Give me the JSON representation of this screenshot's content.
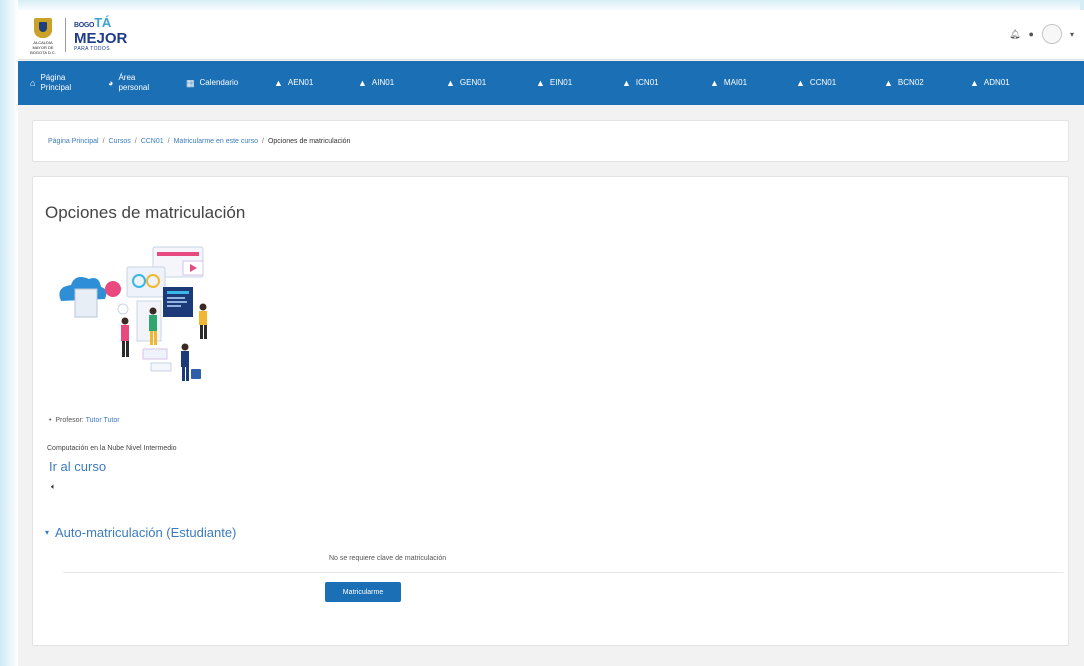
{
  "header": {
    "crest_text": "ALCALDIA MAYOR DE BOGOTA D.C.",
    "brand_prefix": "BOGO",
    "brand_accent": "TÁ",
    "brand_line2": "MEJOR",
    "brand_line3": "PARA TODOS"
  },
  "nav": {
    "items": [
      {
        "icon": "home-icon",
        "line1": "Página",
        "line2": "Principal"
      },
      {
        "icon": "dashboard-icon",
        "line1": "Área",
        "line2": "personal"
      },
      {
        "icon": "calendar-icon",
        "line1": "Calendario",
        "line2": ""
      },
      {
        "icon": "graduation-cap-icon",
        "line1": "AEN01",
        "line2": ""
      },
      {
        "icon": "graduation-cap-icon",
        "line1": "AIN01",
        "line2": ""
      },
      {
        "icon": "graduation-cap-icon",
        "line1": "GEN01",
        "line2": ""
      },
      {
        "icon": "graduation-cap-icon",
        "line1": "EIN01",
        "line2": ""
      },
      {
        "icon": "graduation-cap-icon",
        "line1": "ICN01",
        "line2": ""
      },
      {
        "icon": "graduation-cap-icon",
        "line1": "MAI01",
        "line2": ""
      },
      {
        "icon": "graduation-cap-icon",
        "line1": "CCN01",
        "line2": ""
      },
      {
        "icon": "graduation-cap-icon",
        "line1": "BCN02",
        "line2": ""
      },
      {
        "icon": "graduation-cap-icon",
        "line1": "ADN01",
        "line2": ""
      }
    ]
  },
  "breadcrumb": {
    "items": [
      "Página Principal",
      "Cursos",
      "CCN01",
      "Matricularme en este curso"
    ],
    "current": "Opciones de matriculación"
  },
  "main": {
    "title": "Opciones de matriculación",
    "teacher_label": "Profesor:",
    "teacher_name": "Tutor Tutor",
    "summary": "Computación en la Nube Nivel Intermedio",
    "go_course": "Ir al curso",
    "section_title": "Auto-matriculación (Estudiante)",
    "no_key": "No se requiere clave de matriculación",
    "enroll_button": "Matricularme"
  },
  "colors": {
    "nav_bg": "#1b6fb5",
    "link": "#3b7bbf",
    "brand": "#1f3c8c"
  }
}
